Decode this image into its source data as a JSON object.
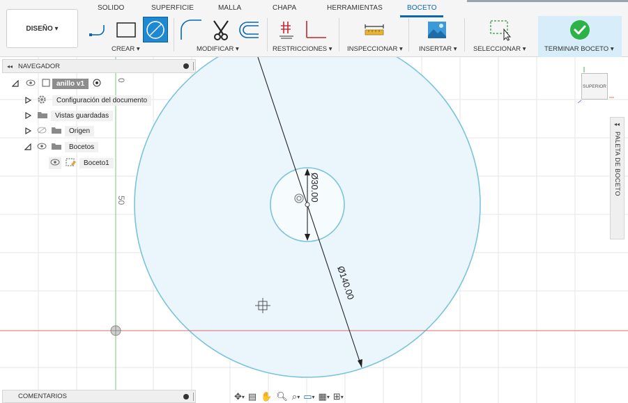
{
  "toolbar": {
    "tabs": [
      "SOLIDO",
      "SUPERFICIE",
      "MALLA",
      "CHAPA",
      "HERRAMIENTAS",
      "BOCETO"
    ],
    "active_tab": "BOCETO",
    "workspace_button": "DISEÑO ▾",
    "groups": {
      "crear": "CREAR ▾",
      "modificar": "MODIFICAR ▾",
      "restricciones": "RESTRICCIONES ▾",
      "inspeccionar": "INSPECCIONAR ▾",
      "insertar": "INSERTAR ▾",
      "seleccionar": "SELECCIONAR ▾",
      "terminar": "TERMINAR BOCETO ▾"
    }
  },
  "navigator": {
    "title": "NAVEGADOR",
    "root": "anillo v1",
    "items": [
      {
        "label": "Configuración del documento",
        "icon": "gear-icon"
      },
      {
        "label": "Vistas guardadas",
        "icon": "folder-icon"
      },
      {
        "label": "Origen",
        "icon": "folder-icon"
      },
      {
        "label": "Bocetos",
        "icon": "folder-icon"
      },
      {
        "label": "Boceto1",
        "icon": "sketch-icon"
      }
    ]
  },
  "comments": {
    "title": "COMENTARIOS"
  },
  "palette": {
    "title": "PALETA DE BOCETO"
  },
  "viewcube": {
    "face": "SUPERIOR"
  },
  "canvas": {
    "ruler_labels": [
      "0",
      "50"
    ],
    "dimensions": {
      "inner": "Ø30.00",
      "outer": "Ø140.00"
    },
    "colors": {
      "circle_stroke": "#7ac3dc",
      "circle_fill": "#eaf5fc",
      "y_axis": "#8fd18f",
      "x_axis": "#d96b6b",
      "accent": "#0a67b0",
      "finish_green": "#2db24a"
    }
  }
}
